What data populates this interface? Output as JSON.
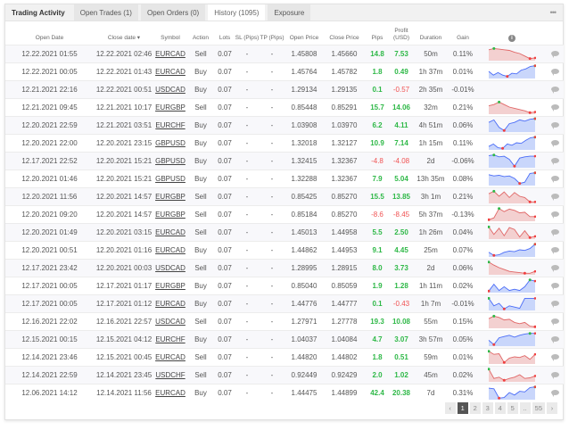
{
  "tabs": [
    {
      "label": "Trading Activity"
    },
    {
      "label": "Open Trades (1)"
    },
    {
      "label": "Open Orders (0)"
    },
    {
      "label": "History (1095)"
    },
    {
      "label": "Exposure"
    }
  ],
  "more_label": "•••",
  "columns": {
    "open_date": "Open Date",
    "close_date": "Close date ▾",
    "symbol": "Symbol",
    "action": "Action",
    "lots": "Lots",
    "sl": "SL (Pips)",
    "tp": "TP (Pips)",
    "open_price": "Open Price",
    "close_price": "Close Price",
    "pips": "Pips",
    "profit": "Profit (USD)",
    "duration": "Duration",
    "gain": "Gain",
    "info": "i"
  },
  "colors": {
    "buy": "#4a6cf7",
    "sell": "#e06666",
    "positive": "#2eb847",
    "negative": "#f05252"
  },
  "rows": [
    [
      "12.22.2021 01:55",
      "12.22.2021 02:46",
      "EURCAD",
      "Sell",
      "0.07",
      "-",
      "-",
      "1.45808",
      "1.45660",
      "14.8",
      "7.53",
      "50m",
      "0.11%",
      [
        0.8,
        0.9,
        0.85,
        0.8,
        0.75,
        0.6,
        0.5,
        0.3,
        0.1,
        0.15
      ]
    ],
    [
      "12.22.2021 00:05",
      "12.22.2021 01:43",
      "EURCAD",
      "Buy",
      "0.07",
      "-",
      "-",
      "1.45764",
      "1.45782",
      "1.8",
      "0.49",
      "1h 37m",
      "0.01%",
      [
        0.5,
        0.2,
        0.4,
        0.2,
        0.1,
        0.35,
        0.3,
        0.6,
        0.7,
        0.9,
        0.95
      ]
    ],
    [
      "12.21.2021 22:16",
      "12.22.2021 00:51",
      "USDCAD",
      "Buy",
      "0.07",
      "-",
      "-",
      "1.29134",
      "1.29135",
      "0.1",
      "-0.57",
      "2h 35m",
      "-0.01%",
      []
    ],
    [
      "12.21.2021 09:45",
      "12.21.2021 10:17",
      "EURGBP",
      "Sell",
      "0.07",
      "-",
      "-",
      "0.85448",
      "0.85291",
      "15.7",
      "14.06",
      "32m",
      "0.21%",
      [
        0.6,
        0.7,
        0.9,
        0.7,
        0.5,
        0.4,
        0.3,
        0.2,
        0.05,
        0.1
      ]
    ],
    [
      "12.20.2021 22:59",
      "12.21.2021 03:51",
      "EURCHF",
      "Buy",
      "0.07",
      "-",
      "-",
      "1.03908",
      "1.03970",
      "6.2",
      "4.11",
      "4h 51m",
      "0.06%",
      [
        0.7,
        0.9,
        0.3,
        0.05,
        0.6,
        0.7,
        0.9,
        0.8,
        0.95,
        1
      ]
    ],
    [
      "12.20.2021 22:00",
      "12.20.2021 23:15",
      "GBPUSD",
      "Buy",
      "0.07",
      "-",
      "-",
      "1.32018",
      "1.32127",
      "10.9",
      "7.14",
      "1h 15m",
      "0.11%",
      [
        0.2,
        0.4,
        0.1,
        0.05,
        0.4,
        0.3,
        0.5,
        0.45,
        0.7,
        0.9,
        0.95
      ]
    ],
    [
      "12.17.2021 22:52",
      "12.20.2021 15:21",
      "GBPUSD",
      "Buy",
      "0.07",
      "-",
      "-",
      "1.32415",
      "1.32367",
      "-4.8",
      "-4.08",
      "2d",
      "-0.06%",
      [
        0.9,
        0.95,
        0.8,
        0.85,
        0.6,
        0.05,
        0.7,
        0.8,
        0.85,
        0.85
      ]
    ],
    [
      "12.20.2021 01:46",
      "12.20.2021 15:21",
      "GBPUSD",
      "Buy",
      "0.07",
      "-",
      "-",
      "1.32288",
      "1.32367",
      "7.9",
      "5.04",
      "13h 35m",
      "0.08%",
      [
        0.8,
        0.7,
        0.75,
        0.65,
        0.7,
        0.5,
        0.1,
        0.2,
        0.9,
        0.95
      ]
    ],
    [
      "12.20.2021 11:56",
      "12.20.2021 14:57",
      "EURGBP",
      "Sell",
      "0.07",
      "-",
      "-",
      "0.85425",
      "0.85270",
      "15.5",
      "13.85",
      "3h 1m",
      "0.21%",
      [
        0.7,
        0.9,
        0.5,
        0.85,
        0.4,
        0.8,
        0.5,
        0.4,
        0.05,
        0.05
      ]
    ],
    [
      "12.20.2021 09:20",
      "12.20.2021 14:57",
      "EURGBP",
      "Sell",
      "0.07",
      "-",
      "-",
      "0.85184",
      "0.85270",
      "-8.6",
      "-8.45",
      "5h 37m",
      "-0.13%",
      [
        0.05,
        0.2,
        0.95,
        0.7,
        0.9,
        0.8,
        0.6,
        0.65,
        0.3,
        0.3
      ]
    ],
    [
      "12.20.2021 01:49",
      "12.20.2021 03:15",
      "EURCAD",
      "Sell",
      "0.07",
      "-",
      "-",
      "1.45013",
      "1.44958",
      "5.5",
      "2.50",
      "1h 26m",
      "0.04%",
      [
        0.9,
        0.3,
        0.8,
        0.2,
        0.85,
        0.7,
        0.1,
        0.6,
        0.05,
        0.15
      ]
    ],
    [
      "12.20.2021 00:51",
      "12.20.2021 01:16",
      "EURCAD",
      "Buy",
      "0.07",
      "-",
      "-",
      "1.44862",
      "1.44953",
      "9.1",
      "4.45",
      "25m",
      "0.07%",
      [
        0.3,
        0.05,
        0.1,
        0.3,
        0.4,
        0.35,
        0.5,
        0.45,
        0.6,
        0.95
      ]
    ],
    [
      "12.17.2021 23:42",
      "12.20.2021 00:03",
      "USDCAD",
      "Sell",
      "0.07",
      "-",
      "-",
      "1.28995",
      "1.28915",
      "8.0",
      "3.73",
      "2d",
      "0.06%",
      [
        0.95,
        0.7,
        0.5,
        0.35,
        0.2,
        0.15,
        0.1,
        0.05,
        0.05,
        0.2
      ]
    ],
    [
      "12.17.2021 00:05",
      "12.17.2021 01:17",
      "EURGBP",
      "Buy",
      "0.07",
      "-",
      "-",
      "0.85040",
      "0.85059",
      "1.9",
      "1.28",
      "1h 11m",
      "0.02%",
      [
        0.05,
        0.6,
        0.1,
        0.4,
        0.1,
        0.2,
        0.1,
        0.4,
        0.95,
        0.85
      ]
    ],
    [
      "12.17.2021 00:05",
      "12.17.2021 01:12",
      "EURCAD",
      "Buy",
      "0.07",
      "-",
      "-",
      "1.44776",
      "1.44777",
      "0.1",
      "-0.43",
      "1h 7m",
      "-0.01%",
      [
        0.9,
        0.3,
        0.5,
        0.05,
        0.3,
        0.2,
        0.1,
        0.9,
        0.9,
        0.9
      ]
    ],
    [
      "12.16.2021 22:02",
      "12.16.2021 22:57",
      "USDCAD",
      "Sell",
      "0.07",
      "-",
      "-",
      "1.27971",
      "1.27778",
      "19.3",
      "10.08",
      "55m",
      "0.15%",
      [
        0.7,
        0.9,
        0.8,
        0.6,
        0.65,
        0.4,
        0.3,
        0.4,
        0.1,
        0.05
      ]
    ],
    [
      "12.15.2021 00:15",
      "12.15.2021 04:12",
      "EURCHF",
      "Buy",
      "0.07",
      "-",
      "-",
      "1.04037",
      "1.04084",
      "4.7",
      "3.07",
      "3h 57m",
      "0.05%",
      [
        0.4,
        0.05,
        0.6,
        0.7,
        0.8,
        0.65,
        0.8,
        0.9,
        0.95,
        0.95
      ]
    ],
    [
      "12.14.2021 23:46",
      "12.15.2021 00:45",
      "EURCAD",
      "Sell",
      "0.07",
      "-",
      "-",
      "1.44820",
      "1.44802",
      "1.8",
      "0.51",
      "59m",
      "0.01%",
      [
        0.95,
        0.7,
        0.75,
        0.05,
        0.4,
        0.5,
        0.45,
        0.6,
        0.3,
        0.7
      ]
    ],
    [
      "12.14.2021 22:59",
      "12.14.2021 23:45",
      "USDCHF",
      "Sell",
      "0.07",
      "-",
      "-",
      "0.92449",
      "0.92429",
      "2.0",
      "1.02",
      "45m",
      "0.02%",
      [
        0.95,
        0.2,
        0.3,
        0.05,
        0.2,
        0.3,
        0.5,
        0.2,
        0.25,
        0.4
      ]
    ],
    [
      "12.06.2021 14:12",
      "12.14.2021 11:56",
      "EURCAD",
      "Buy",
      "0.07",
      "-",
      "-",
      "1.44475",
      "1.44899",
      "42.4",
      "20.38",
      "7d",
      "0.31%",
      [
        0.85,
        0.8,
        0.05,
        0.1,
        0.5,
        0.3,
        0.6,
        0.55,
        0.9,
        0.95
      ]
    ]
  ],
  "pagination": {
    "prev": "‹",
    "pages": [
      "1",
      "2",
      "3",
      "4",
      "5",
      "..",
      "55"
    ],
    "next": "›",
    "current": "1"
  }
}
